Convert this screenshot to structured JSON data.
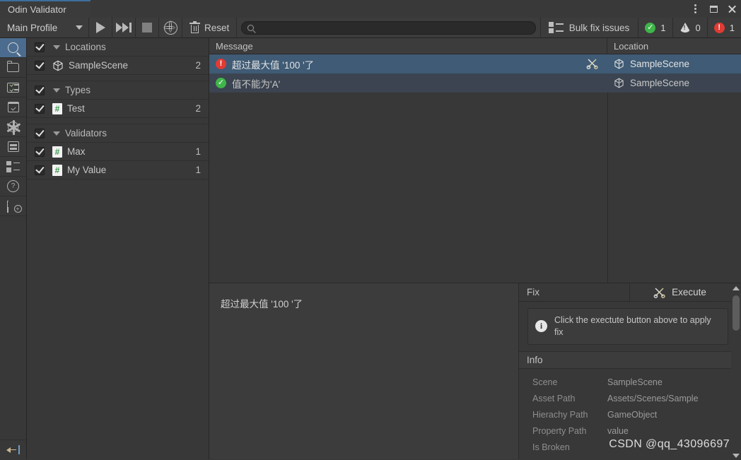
{
  "window": {
    "tab_title": "Odin Validator",
    "controls": {
      "menu": "kebab-menu",
      "maximize": "maximize",
      "close": "close"
    },
    "accent_color": "#3e6e9e"
  },
  "toolbar": {
    "profile_label": "Main Profile",
    "play_icon": "play-icon",
    "forward_icon": "fast-forward-icon",
    "stop_icon": "stop-icon",
    "globe_icon": "globe-icon",
    "reset_label": "Reset",
    "search_value": "",
    "search_placeholder": "",
    "bulk_fix_label": "Bulk fix issues",
    "counters": [
      {
        "type": "ok",
        "value": "1",
        "color": "#3fb54a"
      },
      {
        "type": "warn",
        "value": "0",
        "color": "#d7d7d7"
      },
      {
        "type": "error",
        "value": "1",
        "color": "#e03b34"
      }
    ]
  },
  "rail": {
    "items": [
      {
        "icon": "search-icon",
        "selected": true
      },
      {
        "icon": "folder-icon",
        "selected": false
      },
      {
        "icon": "checklist-icon",
        "selected": false
      },
      {
        "icon": "calendar-check-icon",
        "selected": false
      },
      {
        "icon": "gear-icon",
        "selected": false
      },
      {
        "icon": "database-icon",
        "selected": false
      },
      {
        "icon": "checkbox-list-icon",
        "selected": false
      },
      {
        "icon": "help-icon",
        "selected": false
      },
      {
        "icon": "mail-add-icon",
        "selected": false
      }
    ],
    "back_icon": "back-arrow-icon"
  },
  "tree": {
    "groups": [
      {
        "label": "Locations",
        "checked": true,
        "items": [
          {
            "label": "SampleScene",
            "count": "2",
            "icon": "unity-scene-icon",
            "checked": true
          }
        ]
      },
      {
        "label": "Types",
        "checked": true,
        "items": [
          {
            "label": "Test",
            "count": "2",
            "icon": "script-icon",
            "checked": true
          }
        ]
      },
      {
        "label": "Validators",
        "checked": true,
        "items": [
          {
            "label": "Max",
            "count": "1",
            "icon": "script-icon",
            "checked": true
          },
          {
            "label": "My Value",
            "count": "1",
            "icon": "script-icon",
            "checked": true
          }
        ]
      }
    ]
  },
  "messages": {
    "columns": {
      "message": "Message",
      "location": "Location"
    },
    "rows": [
      {
        "severity": "error",
        "severity_icon": "error-icon",
        "message": "超过最大值 '100 '了",
        "location": "SampleScene",
        "location_icon": "unity-scene-icon",
        "tool_icon": "scissors-icon",
        "selected": true
      },
      {
        "severity": "ok",
        "severity_icon": "success-icon",
        "message": "值不能为'A'",
        "location": "SampleScene",
        "location_icon": "unity-scene-icon",
        "tool_icon": "",
        "selected": false
      }
    ]
  },
  "detail": {
    "text": "超过最大值 '100 '了"
  },
  "fix_panel": {
    "tab_label": "Fix",
    "execute_label": "Execute",
    "execute_icon": "scissors-icon",
    "notice_icon": "info-icon",
    "notice_text": "Click the exectute button above to apply fix",
    "info_header": "Info",
    "info_rows": [
      {
        "key": "Scene",
        "value": "SampleScene"
      },
      {
        "key": "Asset Path",
        "value": "Assets/Scenes/Sample"
      },
      {
        "key": "Hierachy Path",
        "value": "GameObject"
      },
      {
        "key": "Property Path",
        "value": "value"
      },
      {
        "key": "Is Broken",
        "value": ""
      }
    ]
  },
  "watermark": {
    "text": "CSDN @qq_43096697"
  }
}
